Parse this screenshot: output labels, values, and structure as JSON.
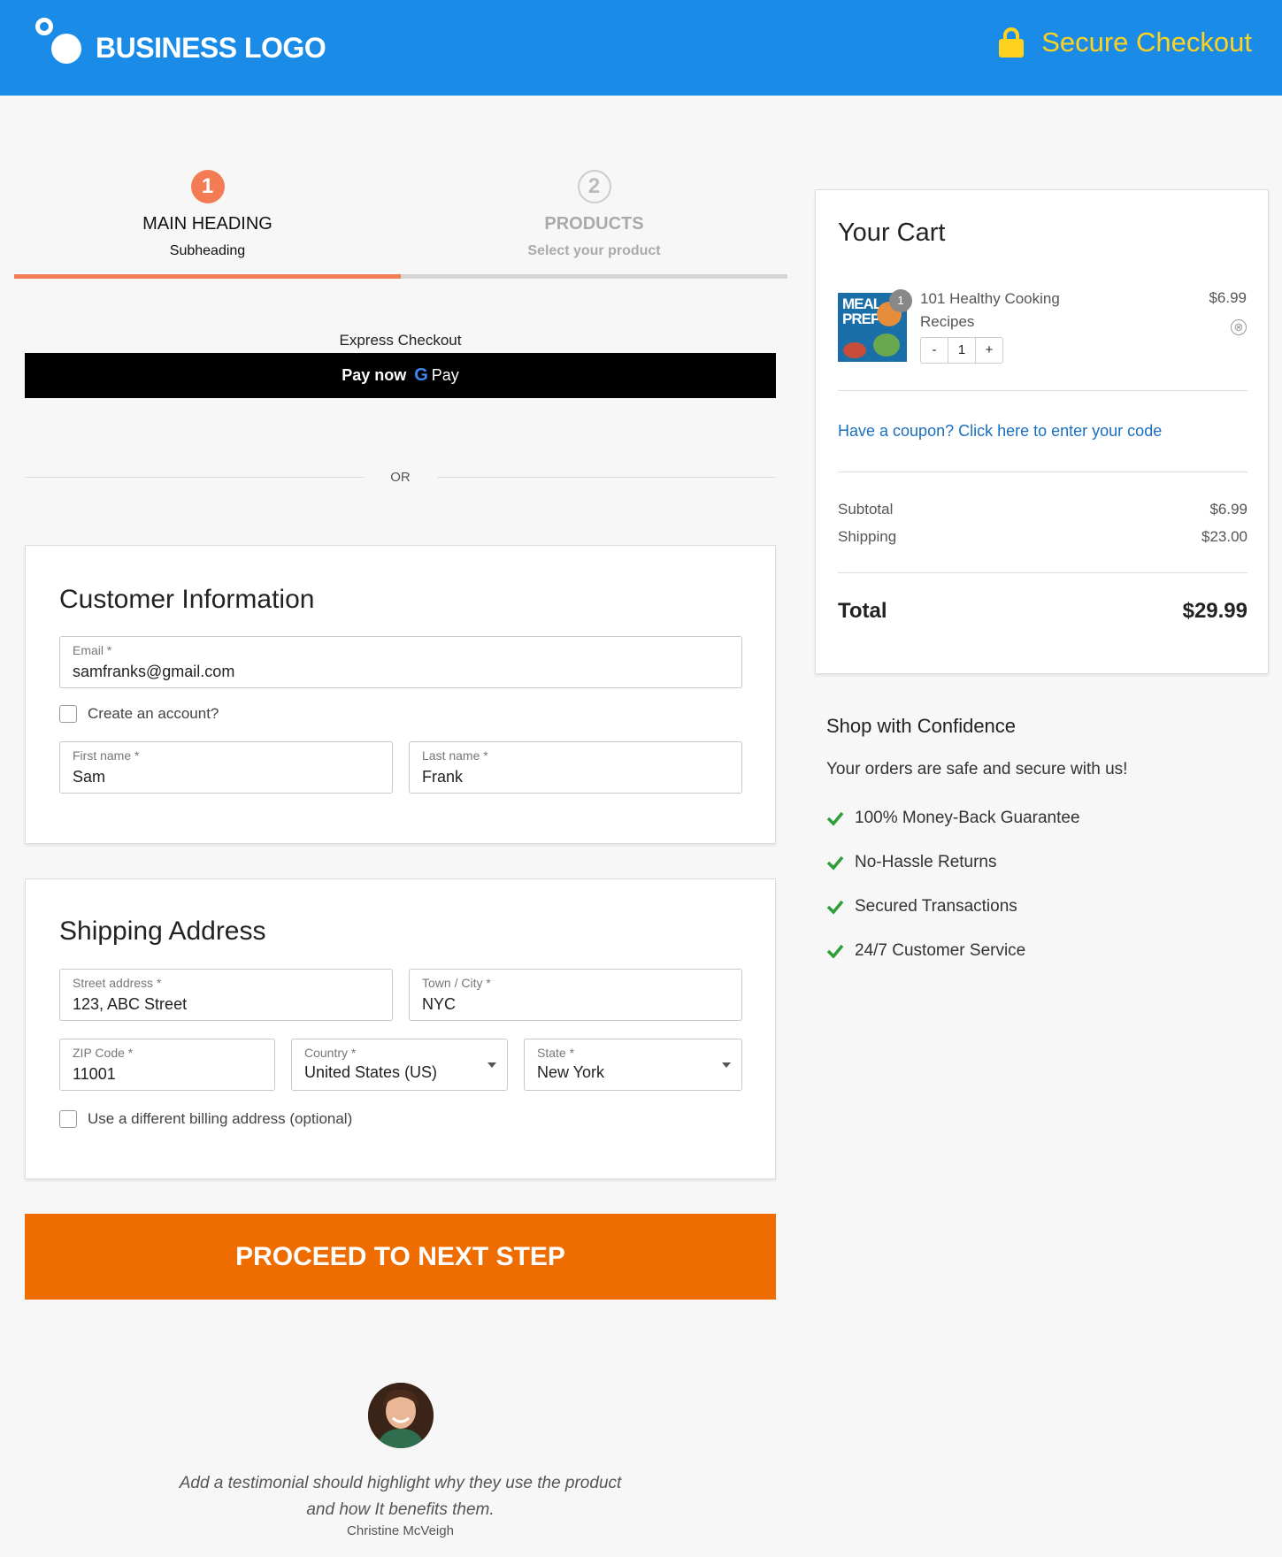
{
  "header": {
    "logo_text": "BUSINESS LOGO",
    "secure_label": "Secure Checkout"
  },
  "steps": [
    {
      "number": "1",
      "title": "MAIN HEADING",
      "subtitle": "Subheading",
      "state": "active"
    },
    {
      "number": "2",
      "title": "PRODUCTS",
      "subtitle": "Select your product",
      "state": "inactive"
    }
  ],
  "express": {
    "label": "Express Checkout",
    "pay_now": "Pay now",
    "g": "G",
    "pay": "Pay",
    "or": "OR"
  },
  "customer": {
    "title": "Customer Information",
    "email_label": "Email *",
    "email_value": "samfranks@gmail.com",
    "create_account": "Create an account?",
    "first_label": "First name *",
    "first_value": "Sam",
    "last_label": "Last name *",
    "last_value": "Frank"
  },
  "shipping": {
    "title": "Shipping Address",
    "street_label": "Street address *",
    "street_value": "123, ABC Street",
    "city_label": "Town / City *",
    "city_value": "NYC",
    "zip_label": "ZIP Code *",
    "zip_value": "11001",
    "country_label": "Country *",
    "country_value": "United States (US)",
    "state_label": "State *",
    "state_value": "New York",
    "billing_option": "Use a different billing address (optional)"
  },
  "proceed_label": "PROCEED TO NEXT STEP",
  "testimonial": {
    "line1": "Add a testimonial should highlight why they use the product",
    "line2": "and how It benefits them.",
    "author": "Christine McVeigh"
  },
  "cart": {
    "title": "Your Cart",
    "thumb_text_1": "MEAL",
    "thumb_text_2": "PREP",
    "item": {
      "name_line1": "101 Healthy Cooking",
      "name_line2": "Recipes",
      "price": "$6.99",
      "qty": "1",
      "minus": "-",
      "plus": "+",
      "remove": "⊗"
    },
    "coupon": "Have a coupon? Click here to enter your code",
    "subtotal_label": "Subtotal",
    "subtotal_value": "$6.99",
    "shipping_label": "Shipping",
    "shipping_value": "$23.00",
    "total_label": "Total",
    "total_value": "$29.99"
  },
  "confidence": {
    "title": "Shop with Confidence",
    "subtitle": "Your orders are safe and secure with us!",
    "items": [
      "100% Money-Back Guarantee",
      "No-Hassle Returns",
      "Secured Transactions",
      "24/7 Customer Service"
    ]
  },
  "colors": {
    "header": "#1a8ce8",
    "accent": "#f47c54",
    "cta": "#ef6c00",
    "secure": "#ffd21f",
    "link": "#1a6fbf",
    "check": "#2e9e3a"
  }
}
